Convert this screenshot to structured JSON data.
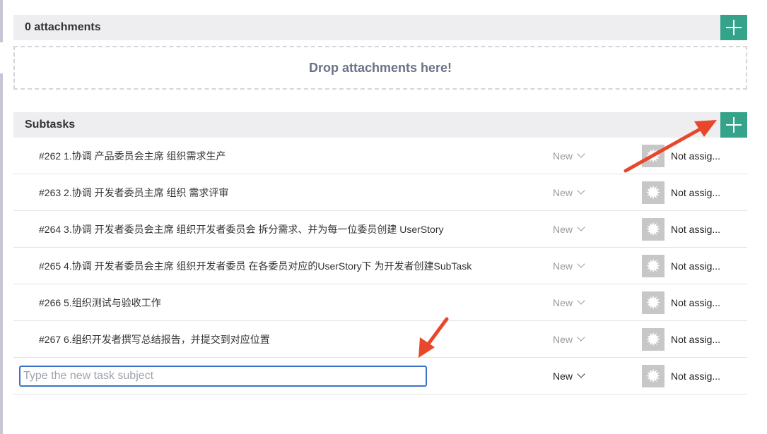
{
  "attachments": {
    "title": "0 attachments",
    "dropzone_text": "Drop attachments here!"
  },
  "subtasks": {
    "title": "Subtasks",
    "rows": [
      {
        "subject": "#262 1.协调 产品委员会主席 组织需求生产",
        "status": "New",
        "assignee": "Not assig..."
      },
      {
        "subject": "#263 2.协调 开发者委员主席 组织 需求评审",
        "status": "New",
        "assignee": "Not assig..."
      },
      {
        "subject": "#264 3.协调 开发者委员会主席 组织开发者委员会 拆分需求、并为每一位委员创建 UserStory",
        "status": "New",
        "assignee": "Not assig..."
      },
      {
        "subject": "#265 4.协调 开发者委员会主席 组织开发者委员 在各委员对应的UserStory下 为开发者创建SubTask",
        "status": "New",
        "assignee": "Not assig..."
      },
      {
        "subject": "#266 5.组织测试与验收工作",
        "status": "New",
        "assignee": "Not assig..."
      },
      {
        "subject": "#267 6.组织开发者撰写总结报告，并提交到对应位置",
        "status": "New",
        "assignee": "Not assig..."
      }
    ],
    "new_task": {
      "placeholder": "Type the new task subject",
      "value": "",
      "status": "New",
      "assignee": "Not assig..."
    }
  },
  "icons": {
    "add": "plus-icon",
    "dropdown": "chevron-down-icon",
    "avatar": "default-avatar-icon",
    "avatar_glyph": "✹"
  },
  "colors": {
    "accent": "#35a28a",
    "header_bg": "#eeeef0",
    "annotation_arrow": "#e8472b",
    "input_focus": "#3c72c8"
  }
}
